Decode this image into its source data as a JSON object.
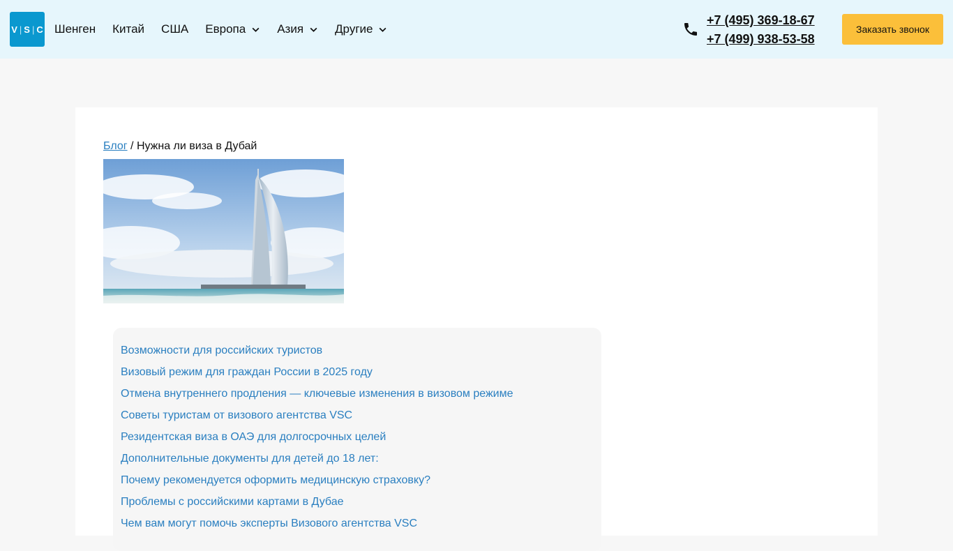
{
  "brand": {
    "logo_text_v": "V",
    "logo_text_s": "S",
    "logo_text_c": "C",
    "logo_sep": "|"
  },
  "nav": {
    "items": [
      {
        "label": "Шенген",
        "has_dropdown": false
      },
      {
        "label": "Китай",
        "has_dropdown": false
      },
      {
        "label": "США",
        "has_dropdown": false
      },
      {
        "label": "Европа",
        "has_dropdown": true
      },
      {
        "label": "Азия",
        "has_dropdown": true
      },
      {
        "label": "Другие",
        "has_dropdown": true
      }
    ]
  },
  "contacts": {
    "phone_1": "+7 (495) 369-18-67",
    "phone_2": "+7 (499) 938-53-58",
    "callback_label": "Заказать звонок"
  },
  "breadcrumb": {
    "link_label": "Блог",
    "separator": "/",
    "current": "Нужна ли виза в Дубай"
  },
  "toc": {
    "items": [
      "Возможности для российских туристов",
      "Визовый режим для граждан России в 2025 году",
      "Отмена внутреннего продления — ключевые изменения в визовом режиме",
      "Советы туристам от визового агентства VSC",
      "Резидентская виза в ОАЭ для долгосрочных целей",
      "Дополнительные документы для детей до 18 лет:",
      "Почему рекомендуется оформить медицинскую страховку?",
      "Проблемы с российскими картами в Дубае",
      "Чем вам могут помочь эксперты Визового агентства VSC"
    ]
  },
  "colors": {
    "header_bg": "#e6f6fc",
    "logo_bg": "#0a98cf",
    "cta_bg": "#fbbf3a",
    "link": "#2a7fc0"
  },
  "icons": {
    "phone": "phone-icon",
    "dropdown": "chevron-down-icon"
  }
}
